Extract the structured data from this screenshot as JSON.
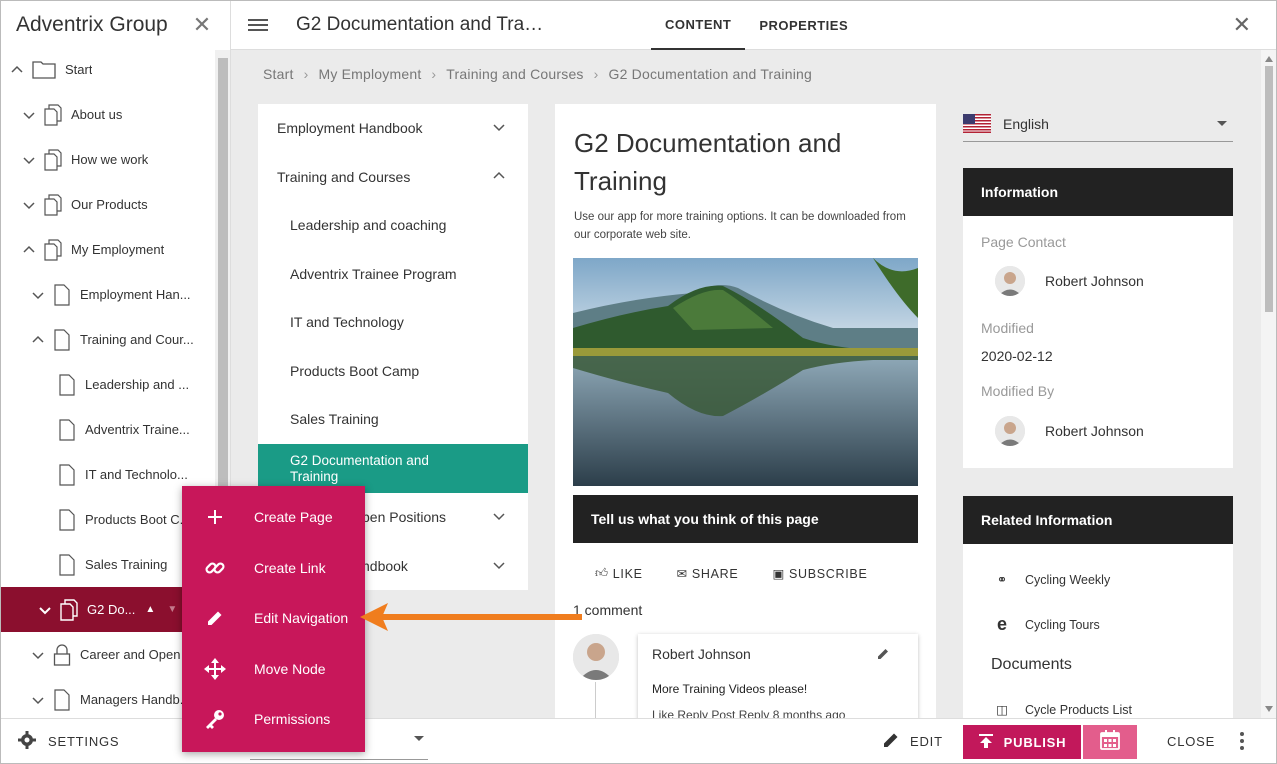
{
  "tree": {
    "title": "Adventrix Group",
    "items": [
      {
        "label": "Start"
      },
      {
        "label": "About us"
      },
      {
        "label": "How we work"
      },
      {
        "label": "Our Products"
      },
      {
        "label": "My Employment"
      },
      {
        "label": "Employment Han..."
      },
      {
        "label": "Training and Cour..."
      },
      {
        "label": "Leadership and ..."
      },
      {
        "label": "Adventrix Traine..."
      },
      {
        "label": "IT and Technolo..."
      },
      {
        "label": "Products Boot C..."
      },
      {
        "label": "Sales Training"
      },
      {
        "label": "G2 Do..."
      },
      {
        "label": "Career and Open ..."
      },
      {
        "label": "Managers Handb..."
      }
    ]
  },
  "topbar": {
    "title": "G2 Documentation and Traini...",
    "tabs": [
      {
        "label": "CONTENT"
      },
      {
        "label": "PROPERTIES"
      }
    ]
  },
  "breadcrumb": [
    "Start",
    "My Employment",
    "Training and Courses",
    "G2 Documentation and Training"
  ],
  "subnav": {
    "items": [
      {
        "label": "Employment Handbook"
      },
      {
        "label": "Training and Courses"
      },
      {
        "label": "Leadership and coaching"
      },
      {
        "label": "Adventrix Trainee Program"
      },
      {
        "label": "IT and Technology"
      },
      {
        "label": "Products Boot Camp"
      },
      {
        "label": "Sales Training"
      },
      {
        "label": "G2 Documentation and Training"
      },
      {
        "label": "pen Positions"
      },
      {
        "label": "ndbook"
      }
    ]
  },
  "article": {
    "title": "G2 Documentation and Training",
    "description": "Use our app for more training options. It can be downloaded from our corporate web site.",
    "feedback": "Tell us what you think of this page",
    "actions": {
      "like": "LIKE",
      "share": "SHARE",
      "subscribe": "SUBSCRIBE"
    },
    "comment_count": "1 comment",
    "comment": {
      "author": "Robert Johnson",
      "text": "More Training Videos please!",
      "meta": "Like   Reply   Post Reply   8 months ago"
    }
  },
  "language": {
    "label": "English"
  },
  "info": {
    "heading": "Information",
    "page_contact_label": "Page Contact",
    "page_contact": "Robert Johnson",
    "modified_label": "Modified",
    "modified": "2020-02-12",
    "modified_by_label": "Modified By",
    "modified_by": "Robert Johnson"
  },
  "related": {
    "heading": "Related Information",
    "links": [
      {
        "label": "Cycling Weekly"
      },
      {
        "label": "Cycling Tours"
      }
    ],
    "documents_heading": "Documents",
    "documents": [
      {
        "label": "Cycle Products List"
      }
    ]
  },
  "bottombar": {
    "settings": "SETTINGS",
    "edit": "EDIT",
    "publish": "PUBLISH",
    "close": "CLOSE"
  },
  "context_menu": {
    "items": [
      {
        "label": "Create Page",
        "icon": "plus-icon"
      },
      {
        "label": "Create Link",
        "icon": "link-icon"
      },
      {
        "label": "Edit Navigation",
        "icon": "pencil-icon"
      },
      {
        "label": "Move Node",
        "icon": "move-icon"
      },
      {
        "label": "Permissions",
        "icon": "key-icon"
      }
    ]
  },
  "colors": {
    "accent_teal": "#1a9b86",
    "tree_active": "#8b0f2e",
    "menu_magenta": "#c8175a",
    "publish": "#c2185b",
    "arrow_orange": "#f07d1e",
    "card_header": "#222222"
  }
}
